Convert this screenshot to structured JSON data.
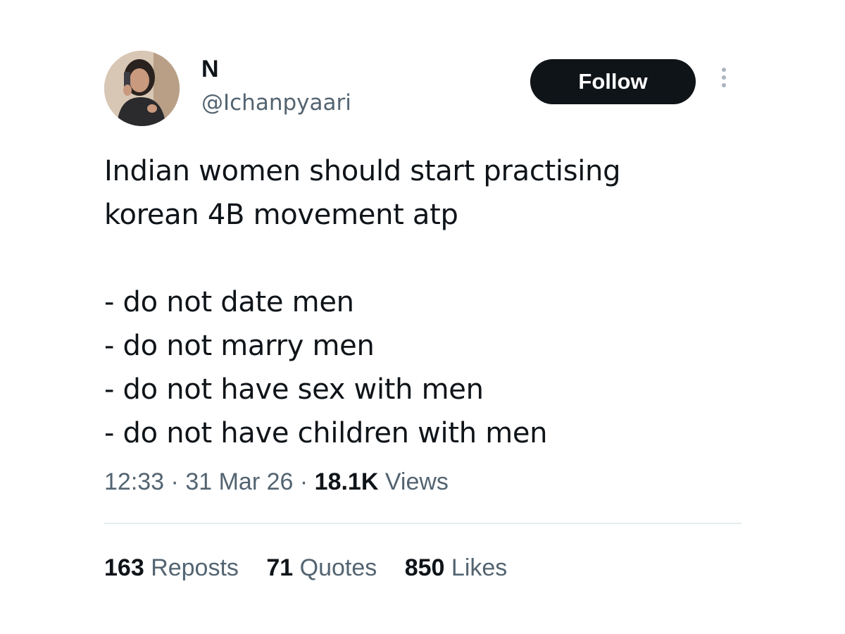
{
  "author": {
    "display_name": "N",
    "handle": "@Ichanpyaari",
    "avatar_icon": "profile-photo-avatar"
  },
  "follow_button": {
    "label": "Follow",
    "background": "#0f1419",
    "text_color": "#ffffff"
  },
  "more_icon": "more-vertical-icon",
  "tweet": {
    "lines": [
      "Indian women should start practising",
      "korean 4B movement atp",
      "",
      "- do not date men",
      "- do not marry men",
      "- do not have sex with men",
      "- do not have children with men"
    ]
  },
  "meta": {
    "time": "12:33",
    "separator": "·",
    "date": "31 Mar 26",
    "views_count": "18.1K",
    "views_label": "Views"
  },
  "stats": [
    {
      "count": "163",
      "label": "Reposts"
    },
    {
      "count": "71",
      "label": "Quotes"
    },
    {
      "count": "850",
      "label": "Likes"
    }
  ],
  "colors": {
    "text_primary": "#0f1419",
    "text_secondary": "#536471",
    "divider": "#e4eaed"
  }
}
